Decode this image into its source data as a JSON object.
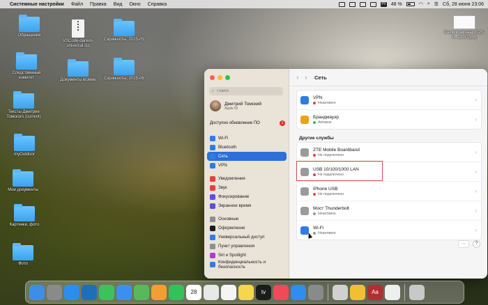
{
  "menubar": {
    "app_name": "Системные настройки",
    "items": [
      "Файл",
      "Правка",
      "Вид",
      "Окно",
      "Справка"
    ],
    "keyboard_layout": "РУ",
    "battery": "48 %",
    "datetime": "Сб, 28 июня  23:06"
  },
  "desktop": {
    "icons": [
      {
        "label": "Обращения"
      },
      {
        "label": "VSCode-darwin-universal.zip"
      },
      {
        "label": "Скриншоты, 2025-05"
      },
      {
        "label": "Следственный комитет"
      },
      {
        "label": "Документы всякие"
      },
      {
        "label": "Скриншоты, 2025-06"
      },
      {
        "label": "Тексты Дмитрия Томского (current)"
      },
      {
        "label": "myOutdoor"
      },
      {
        "label": "Мои документы"
      },
      {
        "label": "Картинки, фото"
      },
      {
        "label": "Фото"
      },
      {
        "label": "Снимок экрана 2025-0...21.37.png"
      }
    ]
  },
  "sidebar": {
    "search_placeholder": "Поиск",
    "account_name": "Дмитрий Томский",
    "account_sub": "Apple ID",
    "update_label": "Доступно обновление ПО",
    "update_count": "1",
    "groups": [
      [
        {
          "label": "Wi-Fi",
          "color": "#2f7de1",
          "icon": "wifi-icon"
        },
        {
          "label": "Bluetooth",
          "color": "#2f7de1",
          "icon": "bluetooth-icon"
        },
        {
          "label": "Сеть",
          "color": "#2f7de1",
          "icon": "network-icon",
          "active": true
        },
        {
          "label": "VPN",
          "color": "#2f7de1",
          "icon": "vpn-icon"
        }
      ],
      [
        {
          "label": "Уведомления",
          "color": "#e0433a",
          "icon": "notifications-icon"
        },
        {
          "label": "Звук",
          "color": "#e0433a",
          "icon": "sound-icon"
        },
        {
          "label": "Фокусирование",
          "color": "#5b4fd8",
          "icon": "focus-icon"
        },
        {
          "label": "Экранное время",
          "color": "#5b4fd8",
          "icon": "screen-time-icon"
        }
      ],
      [
        {
          "label": "Основные",
          "color": "#8e8e93",
          "icon": "gear-icon"
        },
        {
          "label": "Оформление",
          "color": "#1c1c1e",
          "icon": "appearance-icon"
        },
        {
          "label": "Универсальный доступ",
          "color": "#2f7de1",
          "icon": "accessibility-icon"
        },
        {
          "label": "Пункт управления",
          "color": "#8e8e93",
          "icon": "control-center-icon"
        },
        {
          "label": "Siri и Spotlight",
          "color": "#b03ad6",
          "icon": "siri-icon"
        },
        {
          "label": "Конфиденциальность и безопасность",
          "color": "#2f7de1",
          "icon": "privacy-icon"
        }
      ]
    ]
  },
  "content": {
    "title": "Сеть",
    "top_services": [
      {
        "name": "VPN",
        "status": "Неактивно",
        "status_color": "#e0433a",
        "icon_color": "#2f7de1",
        "icon": "vpn-icon"
      },
      {
        "name": "Брандмауэр",
        "status": "Активно",
        "status_color": "#2fbf4f",
        "icon_color": "#f0a020",
        "icon": "firewall-icon"
      }
    ],
    "other_title": "Другие службы",
    "other_services": [
      {
        "name": "ZTE Mobile Boardband",
        "status": "Не подключено",
        "status_color": "#e0433a",
        "icon_color": "#9a9a9a",
        "icon": "modem-icon"
      },
      {
        "name": "USB 10/100/1000 LAN",
        "status": "Не подключено",
        "status_color": "#e0433a",
        "icon_color": "#9a9a9a",
        "icon": "ethernet-icon"
      },
      {
        "name": "iPhone USB",
        "status": "Не подключено",
        "status_color": "#e0433a",
        "icon_color": "#9a9a9a",
        "icon": "phone-icon"
      },
      {
        "name": "Мост Thunderbolt",
        "status": "Неактивно",
        "status_color": "#9a9a9a",
        "icon_color": "#9a9a9a",
        "icon": "thunderbolt-icon"
      },
      {
        "name": "Wi-Fi",
        "status": "Неактивно",
        "status_color": "#9a9a9a",
        "icon_color": "#2f7de1",
        "icon": "wifi-icon"
      }
    ],
    "more_label": "···",
    "help_label": "?"
  },
  "dock": {
    "apps": [
      {
        "name": "finder-icon",
        "color": "#3b8fe8"
      },
      {
        "name": "launchpad-icon",
        "color": "#8a8a8a"
      },
      {
        "name": "safari-icon",
        "color": "#2c8cf0"
      },
      {
        "name": "vscode-icon",
        "color": "#1f6fb8"
      },
      {
        "name": "messages-icon",
        "color": "#3ac35a"
      },
      {
        "name": "mail-icon",
        "color": "#3a90f0"
      },
      {
        "name": "maps-icon",
        "color": "#58b85a"
      },
      {
        "name": "photos-icon",
        "color": "#f0a030"
      },
      {
        "name": "facetime-icon",
        "color": "#36c05a"
      },
      {
        "name": "calendar-icon",
        "color": "#ffffff",
        "text": "28"
      },
      {
        "name": "chrome-icon",
        "color": "#e8e8e8"
      },
      {
        "name": "reminders-icon",
        "color": "#f5f5f5"
      },
      {
        "name": "notes-icon",
        "color": "#f6d64a"
      },
      {
        "name": "appletv-icon",
        "color": "#1c1c1c",
        "text": "tv"
      },
      {
        "name": "music-icon",
        "color": "#f04a5a"
      },
      {
        "name": "appstore-icon",
        "color": "#2f8cf0"
      },
      {
        "name": "system-settings-icon",
        "color": "#8a8a8a"
      },
      {
        "name": "utility-icon",
        "color": "#d0d0d0"
      },
      {
        "name": "taurus-icon",
        "color": "#f0c030"
      },
      {
        "name": "dictionary-icon",
        "color": "#b03030",
        "text": "Aa"
      },
      {
        "name": "textedit-icon",
        "color": "#efefef"
      },
      {
        "name": "trash-icon",
        "color": "#c8c8c8"
      }
    ]
  }
}
